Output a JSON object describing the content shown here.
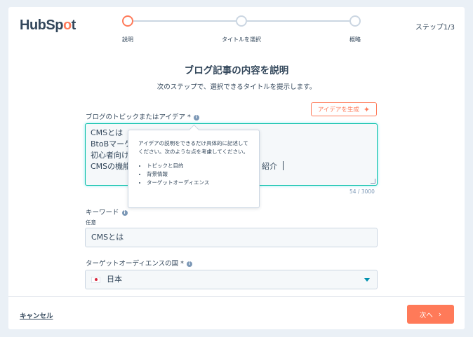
{
  "header": {
    "logo_prefix": "HubSp",
    "logo_o": "o",
    "logo_suffix": "t",
    "step_count": "ステップ1/3",
    "steps": [
      {
        "label": "説明",
        "active": true
      },
      {
        "label": "タイトルを選択",
        "active": false
      },
      {
        "label": "概略",
        "active": false
      }
    ]
  },
  "main": {
    "title": "ブログ記事の内容を説明",
    "subtitle": "次のステップで、選択できるタイトルを提示します。",
    "generate_idea_button": "アイデアを生成",
    "topic_label": "ブログのトピックまたはアイデア *",
    "topic_lines": [
      "CMSとは",
      "BtoBマーケ",
      "初心者向け",
      "CMSの機能"
    ],
    "topic_tail": "紹介",
    "char_count": "54 / 3000",
    "tooltip": {
      "intro": "アイデアの説明をできるだけ具体的に記述してください。次のような点を考慮してください。",
      "bullets": [
        "トピックと目的",
        "背景情報",
        "ターゲットオーディエンス"
      ]
    },
    "keyword_label": "キーワード",
    "keyword_optional": "任意",
    "keyword_value": "CMSとは",
    "country_label": "ターゲットオーディエンスの国 *",
    "country_value": "日本"
  },
  "footer": {
    "cancel": "キャンセル",
    "next": "次へ"
  },
  "colors": {
    "accent": "#ff7a59",
    "focus": "#00bda5",
    "text": "#33475b"
  }
}
